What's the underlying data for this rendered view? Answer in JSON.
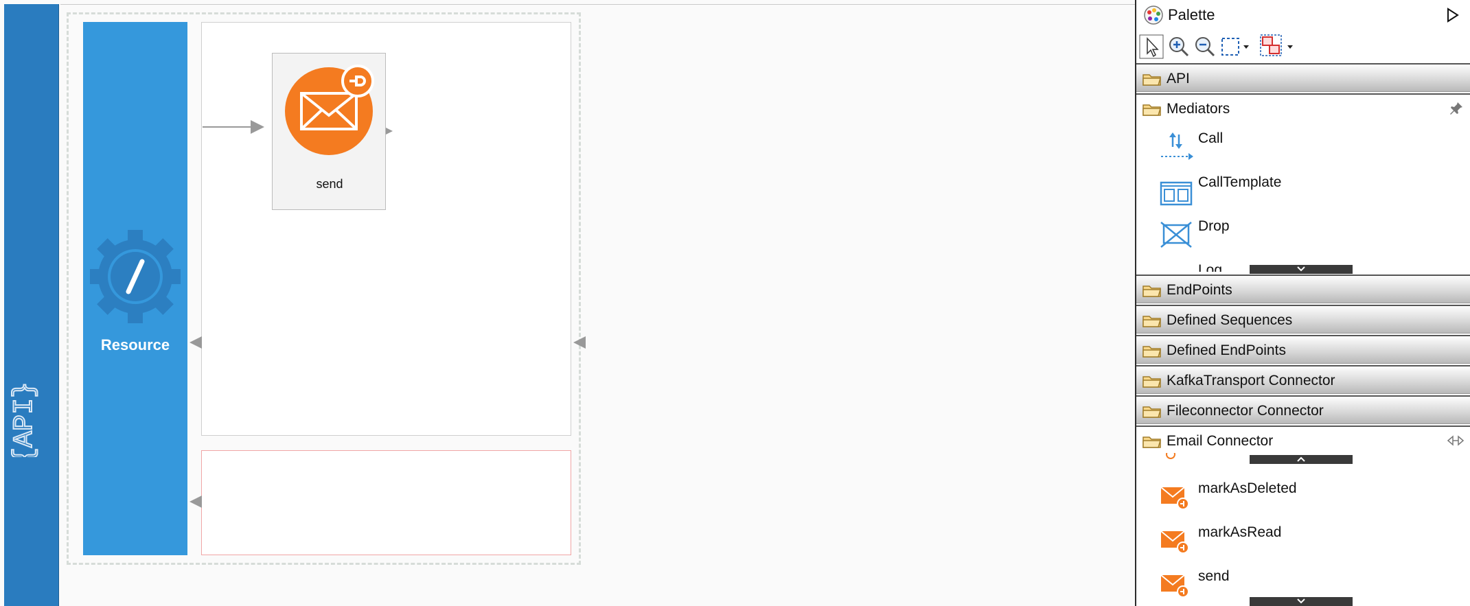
{
  "api_strip": {
    "label": "{API}"
  },
  "canvas": {
    "resource_label": "Resource",
    "mediator_label": "send"
  },
  "palette": {
    "title": "Palette",
    "drawers": {
      "api": "API",
      "mediators": "Mediators",
      "endpoints": "EndPoints",
      "defined_sequences": "Defined Sequences",
      "defined_endpoints": "Defined EndPoints",
      "kafka": "KafkaTransport Connector",
      "fileconnector": "Fileconnector Connector",
      "email": "Email Connector"
    },
    "mediator_items": [
      "Call",
      "CallTemplate",
      "Drop",
      "Log"
    ],
    "email_items": [
      "markAsDeleted",
      "markAsRead",
      "send"
    ]
  },
  "colors": {
    "api_strip": "#2a7cbf",
    "resource": "#3598dc",
    "mediator_orange": "#f47b20"
  }
}
